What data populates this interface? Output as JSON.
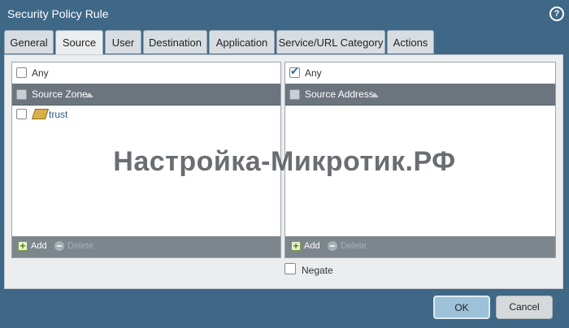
{
  "window": {
    "title": "Security Policy Rule",
    "help_icon": "help-icon"
  },
  "tabs": [
    {
      "label": "General",
      "active": false
    },
    {
      "label": "Source",
      "active": true
    },
    {
      "label": "User",
      "active": false
    },
    {
      "label": "Destination",
      "active": false
    },
    {
      "label": "Application",
      "active": false
    },
    {
      "label": "Service/URL Category",
      "active": false
    },
    {
      "label": "Actions",
      "active": false
    }
  ],
  "source_zone": {
    "any_label": "Any",
    "any_checked": false,
    "column_header": "Source Zone",
    "rows": [
      {
        "label": "trust",
        "icon": "zone-icon",
        "checked": false
      }
    ],
    "add_label": "Add",
    "delete_label": "Delete"
  },
  "source_address": {
    "any_label": "Any",
    "any_checked": true,
    "column_header": "Source Address",
    "rows": [],
    "add_label": "Add",
    "delete_label": "Delete"
  },
  "negate": {
    "label": "Negate",
    "checked": false
  },
  "buttons": {
    "ok_label": "OK",
    "cancel_label": "Cancel"
  },
  "watermark": "Настройка-Микротик.РФ",
  "colors": {
    "title_bar": "#3f6786",
    "header": "#6c757d",
    "footer": "#7d868d",
    "ok_button": "#9cc1d9",
    "link": "#2c5d8a"
  }
}
